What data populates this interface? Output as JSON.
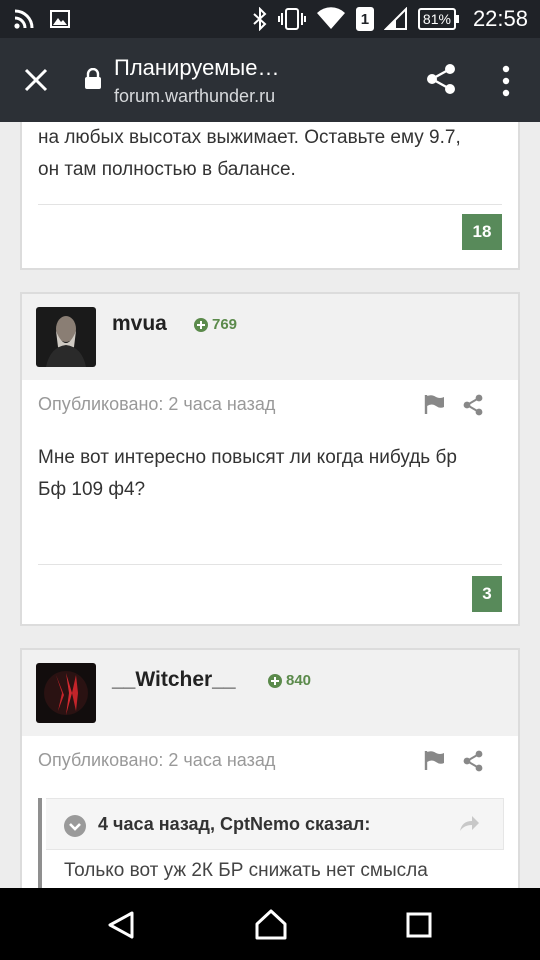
{
  "status_bar": {
    "time": "22:58",
    "battery": "81%",
    "sim": "1",
    "icons": [
      "rss-icon",
      "image-icon",
      "bluetooth-icon",
      "vibrate-icon",
      "wifi-icon",
      "sim-icon",
      "signal-icon",
      "battery-icon"
    ]
  },
  "toolbar": {
    "title": "Планируемые…",
    "url": "forum.warthunder.ru"
  },
  "posts": [
    {
      "text_line1": "на любых высотах выжимает. Оставьте ему 9.7,",
      "text_line2": "он там полностью в балансе.",
      "reactions": "18"
    },
    {
      "username": "mvua",
      "reputation": "769",
      "published": "Опубликовано: 2 часа назад",
      "text_line1": "Мне вот интересно повысят ли когда нибудь бр",
      "text_line2": "Бф 109 ф4?",
      "reactions": "3"
    },
    {
      "username": "__Witcher__",
      "reputation": "840",
      "published": "Опубликовано: 2 часа назад",
      "quote_citation": "4 часа назад, CptNemo сказал:",
      "quote_text": "Только вот уж 2К БР снижать нет смысла"
    }
  ],
  "colors": {
    "status_bar": "#1f2227",
    "toolbar": "#2c3036",
    "reaction_green": "#588a5a",
    "reputation_green": "#5b8a4b"
  }
}
